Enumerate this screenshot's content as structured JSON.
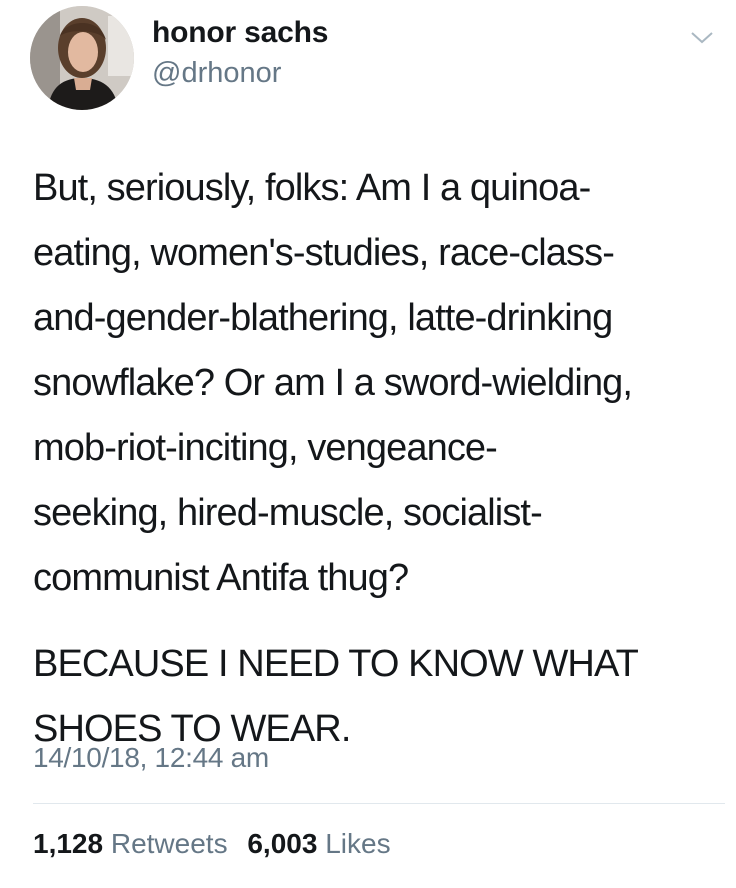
{
  "author": {
    "display_name": "honor sachs",
    "handle": "@drhonor"
  },
  "tweet": {
    "lines": [
      "But, seriously, folks: Am I a quinoa-",
      "eating, women's-studies, race-class-",
      "and-gender-blathering, latte-drinking",
      "snowflake? Or am I a sword-wielding,",
      "mob-riot-inciting, vengeance-",
      "seeking, hired-muscle, socialist-",
      "communist Antifa thug?",
      "BECAUSE I NEED TO KNOW WHAT",
      "SHOES TO WEAR."
    ],
    "timestamp": "14/10/18, 12:44 am"
  },
  "stats": {
    "retweets_count": "1,128",
    "retweets_label": "Retweets",
    "likes_count": "6,003",
    "likes_label": "Likes"
  },
  "icons": {
    "menu": "chevron-down-icon",
    "avatar": "profile-photo"
  },
  "colors": {
    "text": "#14171a",
    "secondary": "#657786",
    "divider": "#e1e8ed"
  }
}
